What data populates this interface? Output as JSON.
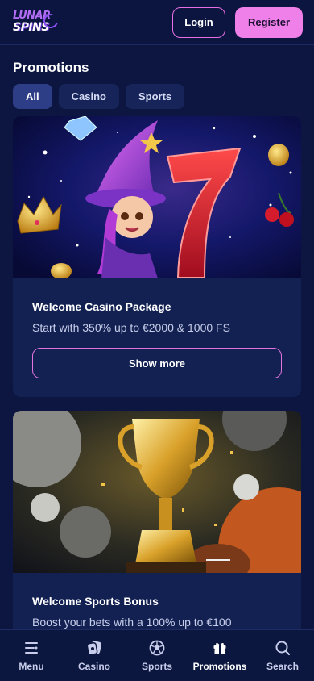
{
  "header": {
    "logo_line1": "LUNAR",
    "logo_line2": "SPINS",
    "login_label": "Login",
    "register_label": "Register"
  },
  "page": {
    "title": "Promotions"
  },
  "filters": [
    {
      "label": "All",
      "active": true
    },
    {
      "label": "Casino",
      "active": false
    },
    {
      "label": "Sports",
      "active": false
    }
  ],
  "promotions": [
    {
      "title": "Welcome Casino Package",
      "description": "Start with 350% up to €2000 & 1000 FS",
      "button_label": "Show more",
      "image": "wizard-girl-slot-7-icon"
    },
    {
      "title": "Welcome Sports Bonus",
      "description": "Boost your bets with a 100% up to €100",
      "image": "golden-trophy-icon"
    }
  ],
  "bottom_nav": [
    {
      "label": "Menu",
      "icon": "menu-icon"
    },
    {
      "label": "Casino",
      "icon": "casino-chip-icon"
    },
    {
      "label": "Sports",
      "icon": "soccer-ball-icon"
    },
    {
      "label": "Promotions",
      "icon": "gift-icon",
      "active": true
    },
    {
      "label": "Search",
      "icon": "search-icon"
    }
  ],
  "colors": {
    "background": "#0c1640",
    "card": "#132152",
    "accent_pink": "#ef7fe9",
    "chip_active": "#2d3e86",
    "chip": "#162459"
  }
}
